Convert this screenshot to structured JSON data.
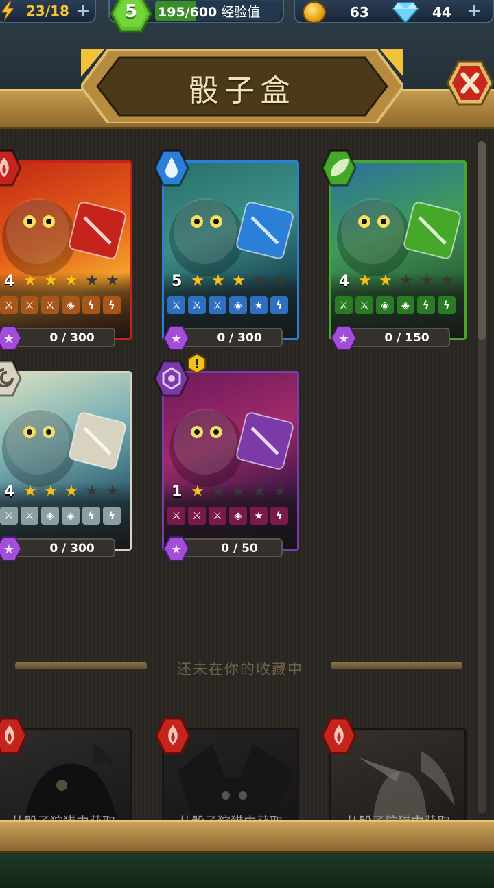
{
  "topbar": {
    "energy": "23/18",
    "level": "5",
    "xp_text": "195/600",
    "xp_label": "经验值",
    "xp_progress": 0.325,
    "coins": "63",
    "gems": "44"
  },
  "title": "骰子盒",
  "owned_cards": [
    {
      "level": "4",
      "stars": 3,
      "element": "fire",
      "color": "#c4241c",
      "faces": [
        "sword",
        "sword",
        "sword",
        "shield",
        "bolt",
        "bolt"
      ],
      "progress": "0 / 300"
    },
    {
      "level": "5",
      "stars": 3,
      "element": "water",
      "color": "#2b7fd6",
      "faces": [
        "sword",
        "sword",
        "sword",
        "shield",
        "star",
        "bolt"
      ],
      "progress": "0 / 300"
    },
    {
      "level": "4",
      "stars": 2,
      "element": "nature",
      "color": "#46a82a",
      "faces": [
        "sword",
        "sword",
        "shield",
        "shield",
        "bolt",
        "bolt"
      ],
      "progress": "0 / 150"
    },
    {
      "level": "4",
      "stars": 3,
      "element": "air",
      "color": "#d8d2c0",
      "faces": [
        "sword",
        "sword",
        "shield",
        "shield",
        "bolt",
        "bolt"
      ],
      "progress": "0 / 300"
    },
    {
      "level": "1",
      "stars": 1,
      "element": "arcane",
      "color": "#7a3aa8",
      "faces": [
        "sword",
        "sword",
        "sword",
        "shield",
        "star",
        "bolt"
      ],
      "progress": "0 / 50"
    }
  ],
  "section_title": "还未在你的收藏中",
  "locked_hint": "从骰子狩猎中获取"
}
